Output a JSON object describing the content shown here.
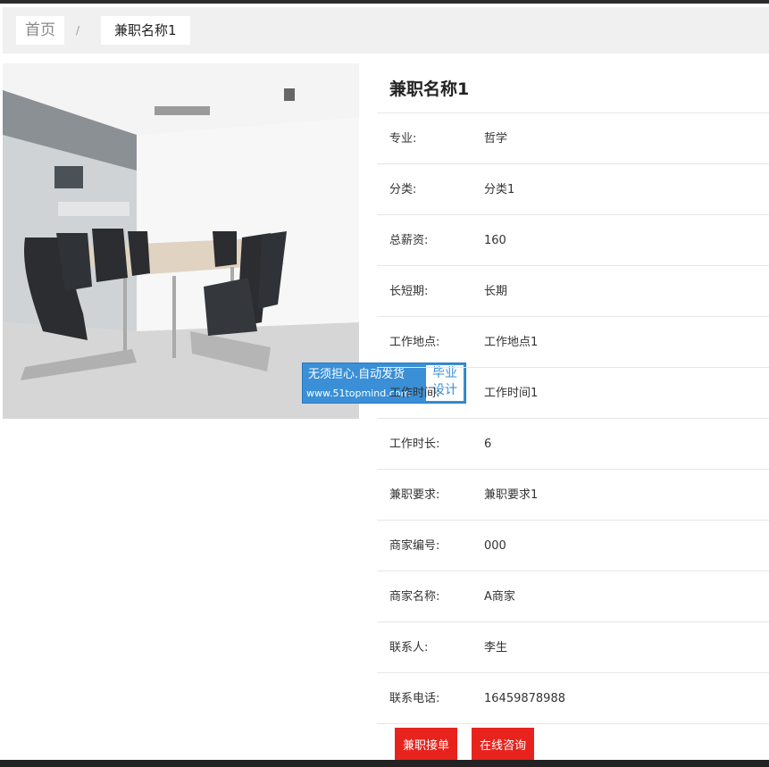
{
  "breadcrumb": {
    "home": "首页",
    "separator": "/",
    "current": "兼职名称1"
  },
  "watermark": {
    "line1": "无须担心.自动发货",
    "line2": "www.51topmind.com",
    "box_line1": "毕业",
    "box_line2": "设计"
  },
  "detail": {
    "title": "兼职名称1",
    "fields": [
      {
        "label": "专业:",
        "value": "哲学"
      },
      {
        "label": "分类:",
        "value": "分类1"
      },
      {
        "label": "总薪资:",
        "value": "160"
      },
      {
        "label": "长短期:",
        "value": "长期"
      },
      {
        "label": "工作地点:",
        "value": "工作地点1"
      },
      {
        "label": "工作时间:",
        "value": "工作时间1"
      },
      {
        "label": "工作时长:",
        "value": "6"
      },
      {
        "label": "兼职要求:",
        "value": "兼职要求1"
      },
      {
        "label": "商家编号:",
        "value": "000"
      },
      {
        "label": "商家名称:",
        "value": "A商家"
      },
      {
        "label": "联系人:",
        "value": "李生"
      },
      {
        "label": "联系电话:",
        "value": "16459878988"
      }
    ]
  },
  "actions": {
    "accept_label": "兼职接单",
    "consult_label": "在线咨询"
  },
  "colors": {
    "button": "#e8231d",
    "watermark": "#3a8fd6"
  }
}
